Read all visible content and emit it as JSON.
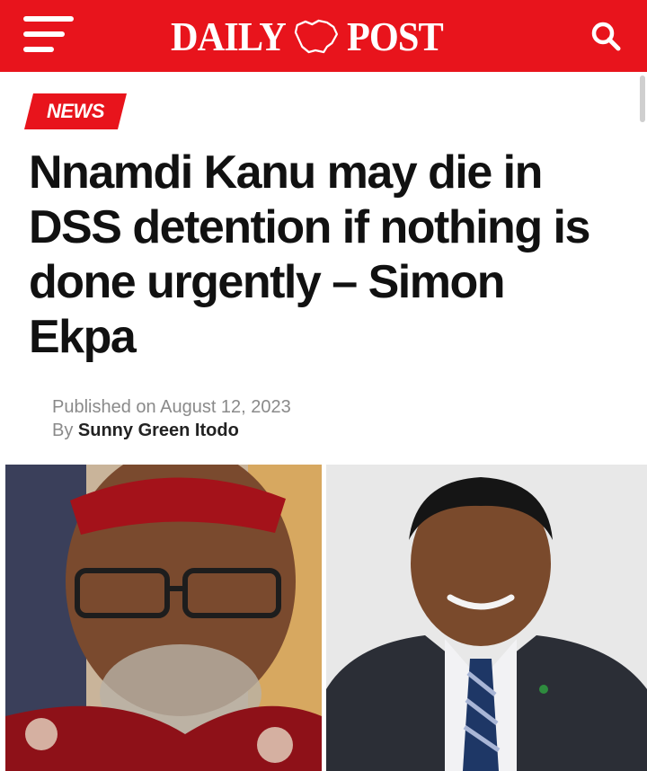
{
  "header": {
    "logo_left": "DAILY",
    "logo_right": "POST",
    "brand_color": "#e8141c",
    "menu_icon": "hamburger-icon",
    "search_icon": "search-icon"
  },
  "article": {
    "category": "NEWS",
    "headline": "Nnamdi Kanu may die in DSS detention if nothing is done urgently – Simon Ekpa",
    "published_prefix": "Published on",
    "published_date": "August 12, 2023",
    "by_prefix": "By",
    "author": "Sunny Green Itodo"
  }
}
